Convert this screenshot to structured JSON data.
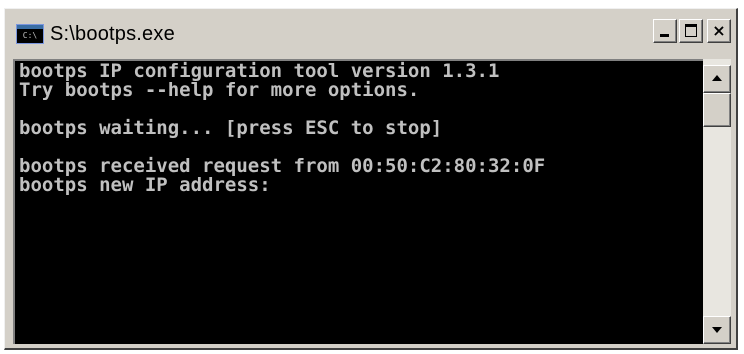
{
  "window": {
    "title": "S:\\bootps.exe",
    "icon": "console-icon",
    "buttons": {
      "minimize_icon": "minimize-icon",
      "maximize_icon": "maximize-icon",
      "close_icon": "close-icon",
      "close_glyph": "×"
    }
  },
  "console": {
    "background": "#000000",
    "foreground": "#c0c0c0",
    "lines": [
      "bootps IP configuration tool version 1.3.1",
      "Try bootps --help for more options.",
      "",
      "bootps waiting... [press ESC to stop]",
      "",
      "bootps received request from 00:50:C2:80:32:0F",
      "bootps new IP address:"
    ]
  },
  "scrollbar": {
    "up_icon": "arrow-up-icon",
    "down_icon": "arrow-down-icon"
  }
}
